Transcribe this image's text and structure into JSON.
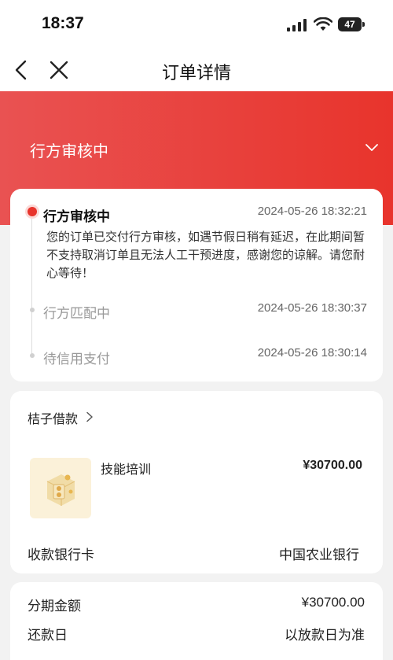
{
  "status_bar": {
    "time": "18:37",
    "battery": "47"
  },
  "nav": {
    "title": "订单详情"
  },
  "hero": {
    "status": "行方审核中"
  },
  "timeline": {
    "steps": [
      {
        "title": "行方审核中",
        "time": "2024-05-26 18:32:21",
        "desc": "您的订单已交付行方审核，如遇节假日稍有延迟，在此期间暂不支持取消订单且无法人工干预进度，感谢您的谅解。请您耐心等待！"
      },
      {
        "title": "行方匹配中",
        "time": "2024-05-26 18:30:37"
      },
      {
        "title": "待信用支付",
        "time": "2024-05-26 18:30:14"
      }
    ]
  },
  "order": {
    "shop_name": "桔子借款",
    "product_name": "技能培训",
    "product_price": "¥30700.00",
    "bank_label": "收款银行卡",
    "bank_value": "中国农业银行"
  },
  "plan": {
    "amount_label": "分期金额",
    "amount_value": "¥30700.00",
    "repay_label": "还款日",
    "repay_value": "以放款日为准"
  },
  "colors": {
    "accent": "#e8342c",
    "hero_start": "#e95252",
    "background": "#f2f2f2"
  },
  "icons": [
    "back-icon",
    "close-icon",
    "chevron-down-icon",
    "chevron-right-icon",
    "signal-icon",
    "wifi-icon",
    "battery-icon",
    "product-icon"
  ]
}
